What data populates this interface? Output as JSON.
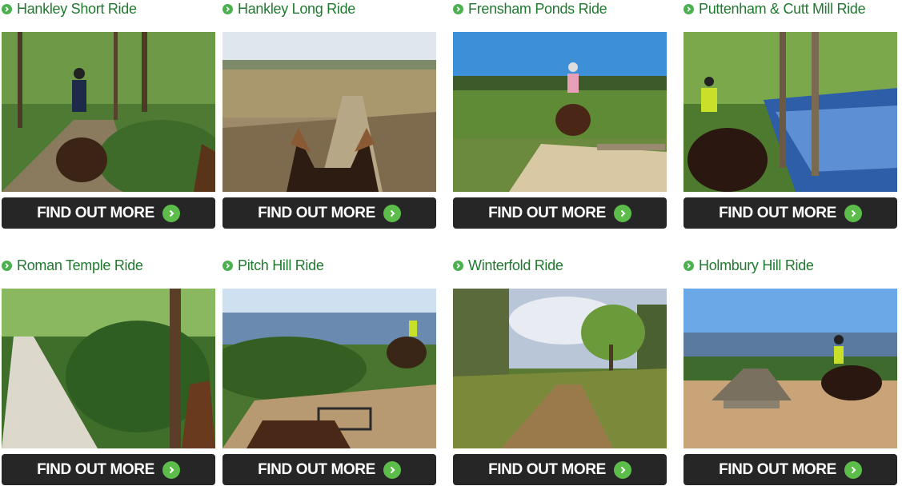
{
  "rides": [
    {
      "title": "Hankley Short Ride",
      "button_label": "FIND OUT MORE"
    },
    {
      "title": "Hankley Long Ride",
      "button_label": "FIND OUT MORE"
    },
    {
      "title": "Frensham Ponds Ride",
      "button_label": "FIND OUT MORE"
    },
    {
      "title": "Puttenham & Cutt Mill Ride",
      "button_label": "FIND OUT MORE"
    },
    {
      "title": "Roman Temple Ride",
      "button_label": "FIND OUT MORE"
    },
    {
      "title": "Pitch Hill Ride",
      "button_label": "FIND OUT MORE"
    },
    {
      "title": "Winterfold Ride",
      "button_label": "FIND OUT MORE"
    },
    {
      "title": "Holmbury Hill Ride",
      "button_label": "FIND OUT MORE"
    }
  ],
  "colors": {
    "title_green": "#1f7a2f",
    "bullet_green": "#4caf50",
    "button_bg": "#262626",
    "button_text": "#ffffff",
    "arrow_green": "#5cbd4a"
  },
  "icons": {
    "title_bullet": "chevron-right-circle-icon",
    "button_arrow": "chevron-right-circle-icon"
  }
}
